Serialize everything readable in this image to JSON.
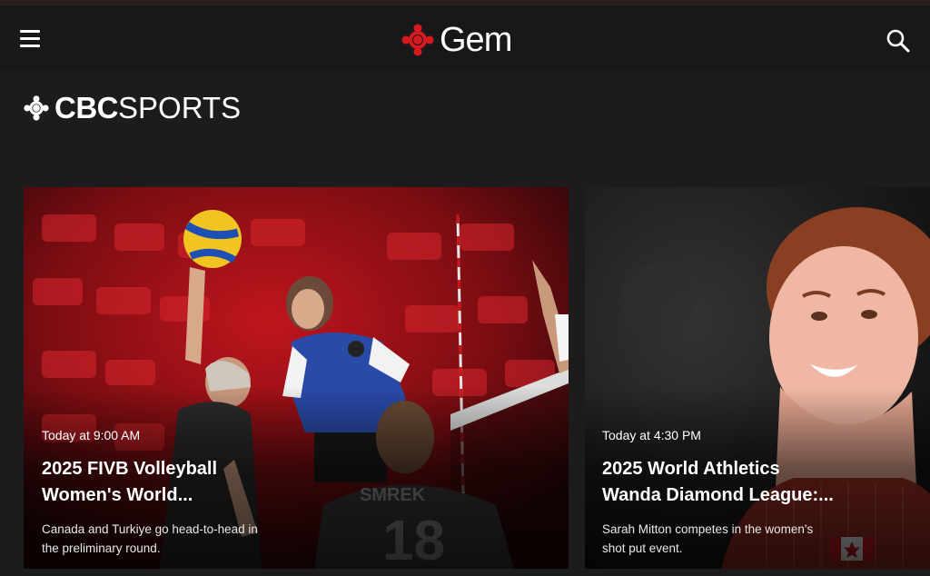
{
  "header": {
    "app_name": "Gem",
    "menu_icon": "hamburger-menu-icon",
    "search_icon": "search-icon",
    "logo_icon": "cbc-gem-logo-icon"
  },
  "section": {
    "brand_bold": "CBC",
    "brand_light": "SPORTS"
  },
  "cards": [
    {
      "time": "Today at 9:00 AM",
      "title_line1": "2025 FIVB Volleyball",
      "title_line2": "Women's World...",
      "desc_line1": "Canada and Turkiye go head-to-head in",
      "desc_line2": "the preliminary round."
    },
    {
      "time": "Today at 4:30 PM",
      "title_line1": "2025 World Athletics",
      "title_line2": "Wanda Diamond League:...",
      "desc_line1": "Sarah Mitton competes in the women's",
      "desc_line2": "shot put event."
    }
  ],
  "colors": {
    "background": "#1c1c1c",
    "header": "#181818",
    "cbc_red": "#d71920",
    "arena_red": "#b8141c"
  }
}
